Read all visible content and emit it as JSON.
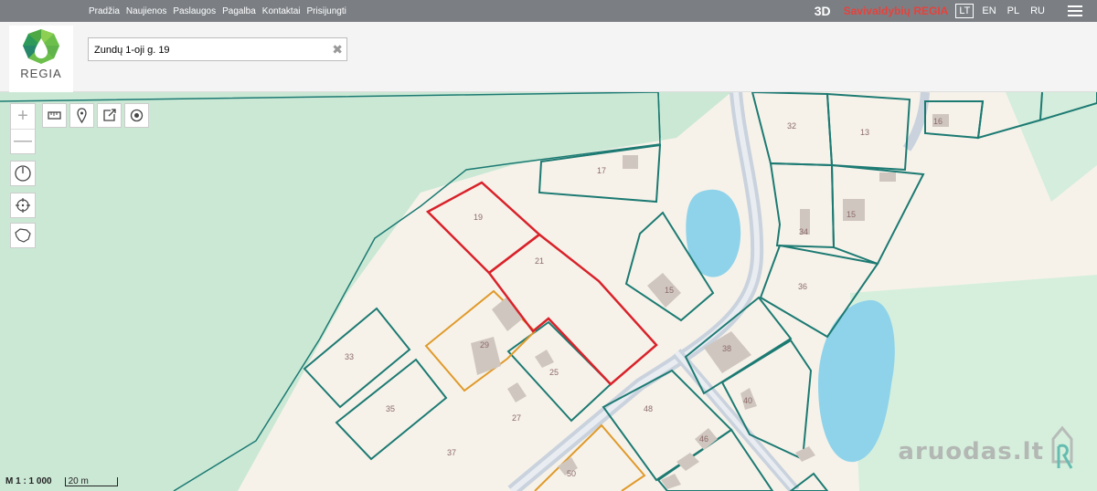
{
  "nav": {
    "items": [
      "Pradžia",
      "Naujienos",
      "Paslaugos",
      "Pagalba",
      "Kontaktai",
      "Prisijungti"
    ],
    "mode_3d": "3D",
    "brand": "Savivaldybių REGIA",
    "languages": [
      "LT",
      "EN",
      "PL",
      "RU"
    ],
    "active_language": "LT"
  },
  "logo": {
    "text": "REGIA"
  },
  "search": {
    "value": "Zundų 1-oji g. 19"
  },
  "map": {
    "parcels": [
      "19",
      "21",
      "17",
      "32",
      "13",
      "16",
      "34",
      "15",
      "15",
      "36",
      "33",
      "35",
      "29",
      "25",
      "27",
      "37",
      "38",
      "40",
      "48",
      "46",
      "50"
    ],
    "scale_ratio": "M 1 : 1 000",
    "scale_bar": "20 m",
    "watermark": "aruodas.lt",
    "colors": {
      "selected_parcel": "#d9222a",
      "parcel": "#1c7a72",
      "orange_parcel": "#e09a2a",
      "water": "#8fd3ea",
      "road": "#c9d2dd",
      "green_area": "#cbe8d5",
      "built_area": "#f6f2ea"
    }
  }
}
